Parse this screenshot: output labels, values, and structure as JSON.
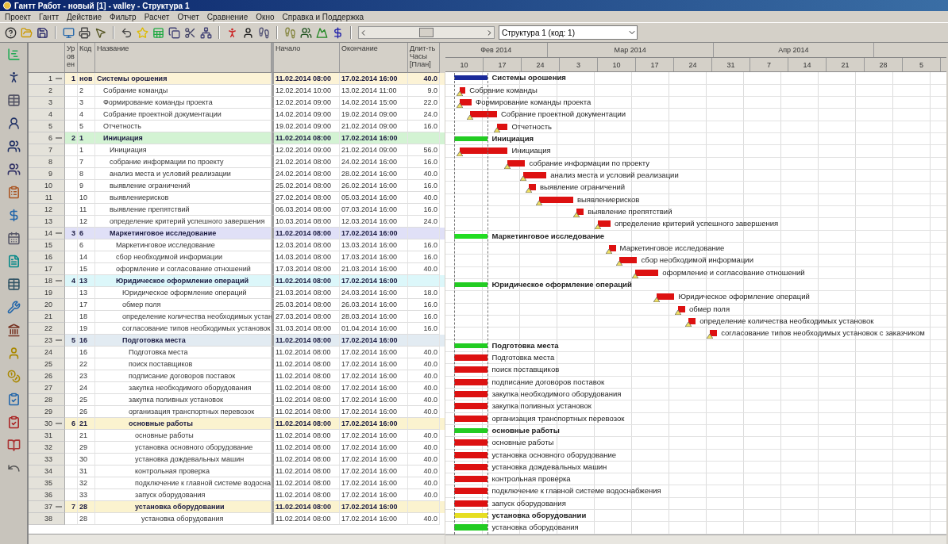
{
  "window": {
    "title": "Гантт Работ - новый [1] - valley - Структура 1"
  },
  "menu": [
    "Проект",
    "Гантт",
    "Действие",
    "Фильтр",
    "Расчет",
    "Отчет",
    "Сравнение",
    "Окно",
    "Справка и Поддержка"
  ],
  "navigator": {
    "level": 0.5
  },
  "structure_combo": {
    "value": "Структура 1 (код: 1)"
  },
  "columns": {
    "tier": "Ур ов ен",
    "code": "Код",
    "name": "Название",
    "start": "Начало",
    "end": "Окончание",
    "duration": "Длит-ть Часы [План]"
  },
  "timeline": {
    "months": [
      "Фев 2014",
      "Мар 2014",
      "Апр 2014"
    ],
    "weeks": [
      "10",
      "17",
      "24",
      "3",
      "10",
      "17",
      "24",
      "31",
      "7",
      "14",
      "21",
      "28",
      "5"
    ]
  },
  "tasks": [
    {
      "kind": "summary",
      "num": "1",
      "expanded": true,
      "tier": "1",
      "code": "нов",
      "name": "Системы орошения",
      "start": "11.02.2014 08:00",
      "end": "17.02.2014 16:00",
      "duration": "40.0",
      "band": {
        "color": "#fcf3d6"
      },
      "color": "#1a2a9a",
      "bar_label": "Системы орошения",
      "children": [
        {
          "kind": "task",
          "num": "2",
          "code": "2",
          "name": "Собрание команды",
          "start": "12.02.2014 10:00",
          "end": "13.02.2014 11:00",
          "duration": "9.0",
          "marker": true,
          "color": "#dd1111",
          "bar_label": "Собрание команды"
        },
        {
          "kind": "task",
          "num": "3",
          "code": "3",
          "name": "Формирование команды проекта",
          "start": "12.02.2014 09:00",
          "end": "14.02.2014 15:00",
          "duration": "22.0",
          "marker": true,
          "color": "#dd1111",
          "bar_label": "Формирование команды проекта"
        },
        {
          "kind": "task",
          "num": "4",
          "code": "4",
          "name": "Собрание проектной документации",
          "start": "14.02.2014 09:00",
          "end": "19.02.2014 09:00",
          "duration": "24.0",
          "marker": true,
          "color": "#dd1111",
          "bar_label": "Собрание проектной документации"
        },
        {
          "kind": "task",
          "num": "5",
          "code": "5",
          "name": "Отчетность",
          "start": "19.02.2014 09:00",
          "end": "21.02.2014 09:00",
          "duration": "16.0",
          "marker": true,
          "color": "#dd1111",
          "bar_label": "Отчетность"
        },
        {
          "kind": "summary",
          "num": "6",
          "expanded": true,
          "tier": "2",
          "code": "1",
          "name": "Инициация",
          "start": "11.02.2014 08:00",
          "end": "17.02.2014 16:00",
          "band": {
            "color": "#d3f3d3"
          },
          "color": "#22cc22",
          "bar_label": "Инициация",
          "children": [
            {
              "kind": "task",
              "num": "7",
              "code": "1",
              "name": "Инициация",
              "start": "12.02.2014 09:00",
              "end": "21.02.2014 09:00",
              "duration": "56.0",
              "marker": true,
              "color": "#dd1111",
              "bar_label": "Инициация"
            },
            {
              "kind": "task",
              "num": "8",
              "code": "7",
              "name": "собрание информации по проекту",
              "start": "21.02.2014 08:00",
              "end": "24.02.2014 16:00",
              "duration": "16.0",
              "marker": true,
              "color": "#dd1111",
              "bar_label": "собрание информации по проекту"
            },
            {
              "kind": "task",
              "num": "9",
              "code": "8",
              "name": "анализ места и условий реализации",
              "start": "24.02.2014 08:00",
              "end": "28.02.2014 16:00",
              "duration": "40.0",
              "marker": true,
              "color": "#dd1111",
              "bar_label": "анализ места и условий реализации"
            },
            {
              "kind": "task",
              "num": "10",
              "code": "9",
              "name": "выявление ограничений",
              "start": "25.02.2014 08:00",
              "end": "26.02.2014 16:00",
              "duration": "16.0",
              "marker": true,
              "color": "#dd1111",
              "bar_label": "выявление ограничений"
            },
            {
              "kind": "task",
              "num": "11",
              "code": "10",
              "name": "выявлениерисков",
              "start": "27.02.2014 08:00",
              "end": "05.03.2014 16:00",
              "duration": "40.0",
              "marker": true,
              "color": "#dd1111",
              "bar_label": "выявлениерисков"
            },
            {
              "kind": "task",
              "num": "12",
              "code": "11",
              "name": "выявление препятствий",
              "start": "06.03.2014 08:00",
              "end": "07.03.2014 16:00",
              "duration": "16.0",
              "marker": true,
              "color": "#dd1111",
              "bar_label": "выявление препятствий"
            },
            {
              "kind": "task",
              "num": "13",
              "code": "12",
              "name": "определение критерий успешного завершения",
              "start": "10.03.2014 08:00",
              "end": "12.03.2014 16:00",
              "duration": "24.0",
              "marker": true,
              "color": "#dd1111",
              "bar_label": "определение критерий успешного завершения"
            },
            {
              "kind": "summary",
              "num": "14",
              "expanded": true,
              "tier": "3",
              "code": "6",
              "name": "Маркетинговое исследование",
              "start": "11.02.2014 08:00",
              "end": "17.02.2014 16:00",
              "band": {
                "color": "#e0e0f7"
              },
              "color": "#22dd22",
              "bar_label": "Маркетинговое исследование",
              "children": [
                {
                  "kind": "task",
                  "num": "15",
                  "code": "6",
                  "name": "Маркетинговое исследование",
                  "start": "12.03.2014 08:00",
                  "end": "13.03.2014 16:00",
                  "duration": "16.0",
                  "marker": true,
                  "color": "#dd1111",
                  "bar_label": "Маркетинговое исследование"
                },
                {
                  "kind": "task",
                  "num": "16",
                  "code": "14",
                  "name": "сбор необходимой информации",
                  "start": "14.03.2014 08:00",
                  "end": "17.03.2014 16:00",
                  "duration": "16.0",
                  "marker": true,
                  "color": "#dd1111",
                  "bar_label": "сбор необходимой информации"
                },
                {
                  "kind": "task",
                  "num": "17",
                  "code": "15",
                  "name": "оформление и согласование отношений",
                  "start": "17.03.2014 08:00",
                  "end": "21.03.2014 16:00",
                  "duration": "40.0",
                  "marker": true,
                  "color": "#dd1111",
                  "bar_label": "оформление и согласование отношений"
                },
                {
                  "kind": "summary",
                  "num": "18",
                  "expanded": true,
                  "tier": "4",
                  "code": "13",
                  "name": "Юридическое оформление операций",
                  "start": "11.02.2014 08:00",
                  "end": "17.02.2014 16:00",
                  "band": {
                    "color": "#dcf7fa"
                  },
                  "color": "#22cc22",
                  "bar_label": "Юридическое оформление операций",
                  "children": [
                    {
                      "kind": "task",
                      "num": "19",
                      "code": "13",
                      "name": "Юридическое оформление операций",
                      "start": "21.03.2014 08:00",
                      "end": "24.03.2014 16:00",
                      "duration": "18.0",
                      "marker": true,
                      "color": "#dd1111",
                      "bar_label": "Юридическое оформление операций"
                    },
                    {
                      "kind": "task",
                      "num": "20",
                      "code": "17",
                      "name": "обмер поля",
                      "start": "25.03.2014 08:00",
                      "end": "26.03.2014 16:00",
                      "duration": "16.0",
                      "marker": true,
                      "color": "#dd1111",
                      "bar_label": "обмер поля"
                    },
                    {
                      "kind": "task",
                      "num": "21",
                      "code": "18",
                      "name": "определение количества необходимых устан",
                      "start": "27.03.2014 08:00",
                      "end": "28.03.2014 16:00",
                      "duration": "16.0",
                      "marker": true,
                      "color": "#dd1111",
                      "bar_label": "определение количества необходимых установок"
                    },
                    {
                      "kind": "task",
                      "num": "22",
                      "code": "19",
                      "name": "согласование типов необходимых установок",
                      "start": "31.03.2014 08:00",
                      "end": "01.04.2014 16:00",
                      "duration": "16.0",
                      "marker": true,
                      "color": "#dd1111",
                      "bar_label": "согласование типов необходимых установок с заказчиком"
                    },
                    {
                      "kind": "summary",
                      "num": "23",
                      "expanded": true,
                      "tier": "5",
                      "code": "16",
                      "name": "Подготовка места",
                      "start": "11.02.2014 08:00",
                      "end": "17.02.2014 16:00",
                      "band": {
                        "color": "#e2ebf2"
                      },
                      "color": "#22cc22",
                      "bar_label": "Подготовка места",
                      "children": [
                        {
                          "kind": "task",
                          "num": "24",
                          "code": "16",
                          "name": "Подготовка места",
                          "start": "11.02.2014 08:00",
                          "end": "17.02.2014 16:00",
                          "duration": "40.0",
                          "color": "#dd1111",
                          "bar_label": "Подготовка места"
                        },
                        {
                          "kind": "task",
                          "num": "25",
                          "code": "22",
                          "name": "поиск поставщиков",
                          "start": "11.02.2014 08:00",
                          "end": "17.02.2014 16:00",
                          "duration": "40.0",
                          "color": "#dd1111",
                          "bar_label": "поиск поставщиков"
                        },
                        {
                          "kind": "task",
                          "num": "26",
                          "code": "23",
                          "name": "подписание договоров поставок",
                          "start": "11.02.2014 08:00",
                          "end": "17.02.2014 16:00",
                          "duration": "40.0",
                          "color": "#dd1111",
                          "bar_label": "подписание договоров поставок"
                        },
                        {
                          "kind": "task",
                          "num": "27",
                          "code": "24",
                          "name": "закупка необходимого оборудования",
                          "start": "11.02.2014 08:00",
                          "end": "17.02.2014 16:00",
                          "duration": "40.0",
                          "color": "#dd1111",
                          "bar_label": "закупка необходимого оборудования"
                        },
                        {
                          "kind": "task",
                          "num": "28",
                          "code": "25",
                          "name": "закупка поливных установок",
                          "start": "11.02.2014 08:00",
                          "end": "17.02.2014 16:00",
                          "duration": "40.0",
                          "color": "#dd1111",
                          "bar_label": "закупка поливных установок"
                        },
                        {
                          "kind": "task",
                          "num": "29",
                          "code": "26",
                          "name": "организация транспортных перевозок",
                          "start": "11.02.2014 08:00",
                          "end": "17.02.2014 16:00",
                          "duration": "40.0",
                          "color": "#dd1111",
                          "bar_label": "организация транспортных перевозок"
                        },
                        {
                          "kind": "summary",
                          "num": "30",
                          "expanded": true,
                          "tier": "6",
                          "code": "21",
                          "name": "основные работы",
                          "start": "11.02.2014 08:00",
                          "end": "17.02.2014 16:00",
                          "band": {
                            "color": "#fbf3cf"
                          },
                          "color": "#22cc22",
                          "bar_label": "основные работы",
                          "children": [
                            {
                              "kind": "task",
                              "num": "31",
                              "code": "21",
                              "name": "основные работы",
                              "start": "11.02.2014 08:00",
                              "end": "17.02.2014 16:00",
                              "duration": "40.0",
                              "color": "#dd1111",
                              "bar_label": "основные работы"
                            },
                            {
                              "kind": "task",
                              "num": "32",
                              "code": "29",
                              "name": "установка основного оборудование",
                              "start": "11.02.2014 08:00",
                              "end": "17.02.2014 16:00",
                              "duration": "40.0",
                              "color": "#dd1111",
                              "bar_label": "установка основного оборудование"
                            },
                            {
                              "kind": "task",
                              "num": "33",
                              "code": "30",
                              "name": "установка дождевальных машин",
                              "start": "11.02.2014 08:00",
                              "end": "17.02.2014 16:00",
                              "duration": "40.0",
                              "color": "#dd1111",
                              "bar_label": "установка дождевальных машин"
                            },
                            {
                              "kind": "task",
                              "num": "34",
                              "code": "31",
                              "name": "контрольная проверка",
                              "start": "11.02.2014 08:00",
                              "end": "17.02.2014 16:00",
                              "duration": "40.0",
                              "color": "#dd1111",
                              "bar_label": "контрольная проверка"
                            },
                            {
                              "kind": "task",
                              "num": "35",
                              "code": "32",
                              "name": "подключение к главной системе водосна",
                              "start": "11.02.2014 08:00",
                              "end": "17.02.2014 16:00",
                              "duration": "40.0",
                              "color": "#dd1111",
                              "bar_label": "подключение к главной системе водоснабжения"
                            },
                            {
                              "kind": "task",
                              "num": "36",
                              "code": "33",
                              "name": "запуск оборудования",
                              "start": "11.02.2014 08:00",
                              "end": "17.02.2014 16:00",
                              "duration": "40.0",
                              "color": "#dd1111",
                              "bar_label": "запуск оборудования"
                            },
                            {
                              "kind": "summary",
                              "num": "37",
                              "expanded": true,
                              "tier": "7",
                              "code": "28",
                              "name": "установка оборудовании",
                              "start": "11.02.2014 08:00",
                              "end": "17.02.2014 16:00",
                              "band": {
                                "color": "#fbf3cf"
                              },
                              "color": "#e6de22",
                              "bar_label": "установка оборудовании",
                              "children": [
                                {
                                  "kind": "task",
                                  "num": "38",
                                  "code": "28",
                                  "name": "установка оборудования",
                                  "start": "11.02.2014 08:00",
                                  "end": "17.02.2014 16:00",
                                  "duration": "40.0",
                                  "color": "#22cc22",
                                  "bar_label": "установка оборудования"
                                }
                              ]
                            }
                          ]
                        }
                      ]
                    }
                  ]
                }
              ]
            }
          ]
        }
      ]
    }
  ]
}
